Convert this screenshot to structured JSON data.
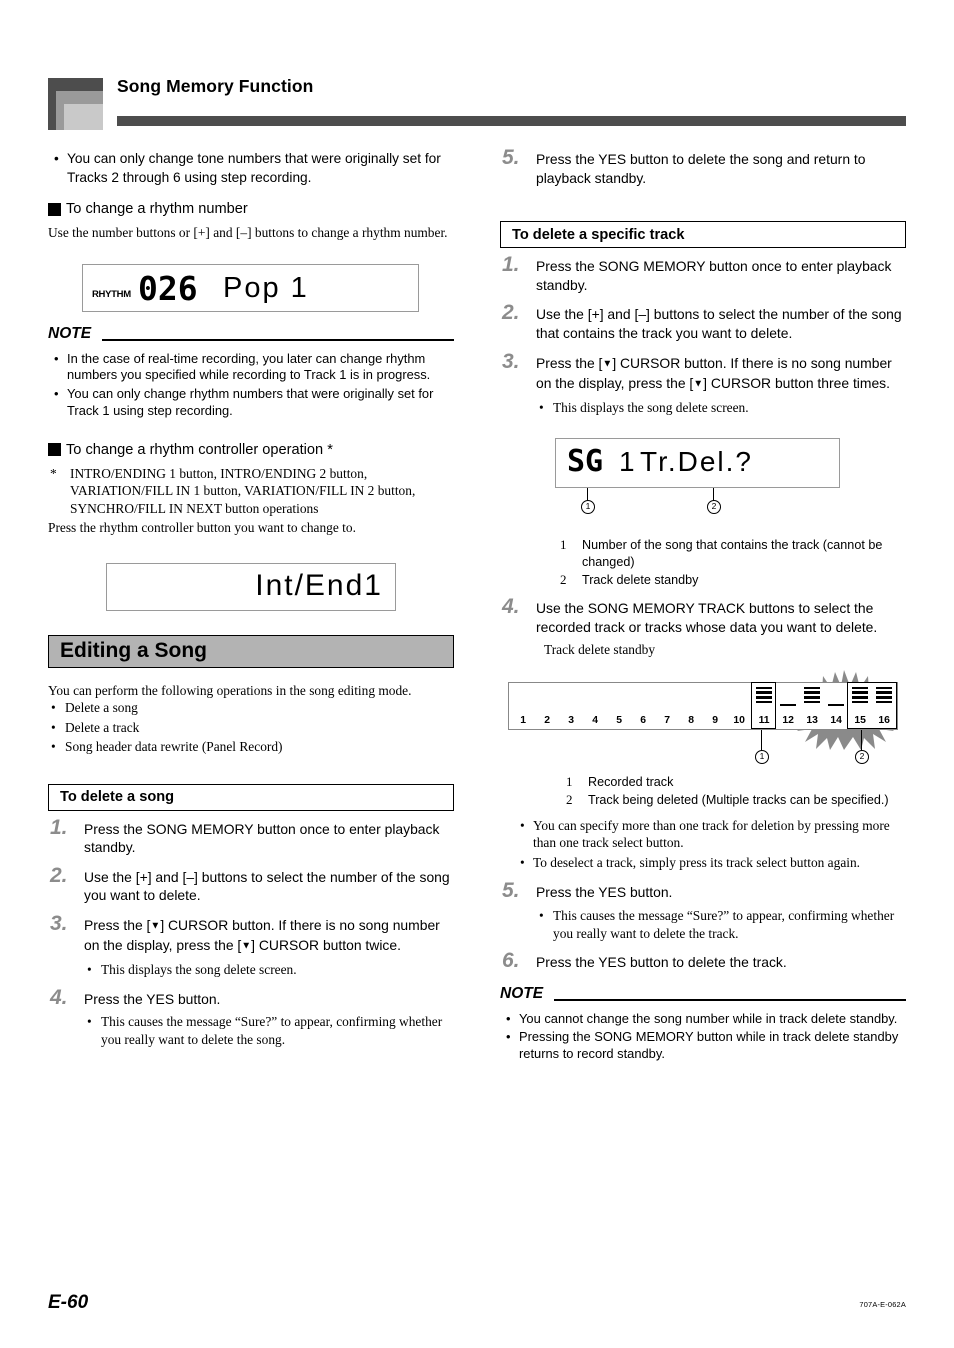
{
  "header": {
    "title": "Song Memory Function"
  },
  "footer": {
    "page_number": "E-60",
    "doc_code": "707A-E-062A"
  },
  "left": {
    "intro_bullet": "You can only change tone numbers that were originally set for Tracks 2 through 6 using step recording.",
    "rhythm_head": "To change a rhythm number",
    "rhythm_body": "Use the number buttons or [+] and [–] buttons to change a rhythm number.",
    "lcd_rhythm": {
      "label": "RHYTHM",
      "number": "026",
      "name": "Pop  1"
    },
    "note_label": "NOTE",
    "notes": [
      "In the case of real-time recording, you later can change rhythm numbers you specified while recording to Track 1 is in progress.",
      "You can only change rhythm numbers that were originally set for Track 1 using step recording."
    ],
    "controller_head": "To change a rhythm controller operation *",
    "controller_footnote_mark": "*",
    "controller_footnote": "INTRO/ENDING 1 button, INTRO/ENDING 2 button, VARIATION/FILL IN 1 button, VARIATION/FILL IN 2 button, SYNCHRO/FILL IN NEXT button operations",
    "controller_body": "Press the rhythm controller button you want to change to.",
    "lcd_controller": "Int/End1",
    "section_banner": "Editing a Song",
    "editing_intro": "You can perform the following operations in the song editing mode.",
    "editing_bullets": [
      "Delete a song",
      "Delete a track",
      "Song header data rewrite (Panel Record)"
    ],
    "proc_title": "To delete a song",
    "steps": [
      {
        "num": "1.",
        "text": "Press the SONG MEMORY button once to enter playback standby."
      },
      {
        "num": "2.",
        "text": "Use the [+] and [–] buttons to select the number of the song you want to delete."
      },
      {
        "num": "3.",
        "text_a": "Press the [",
        "text_b": "] CURSOR button. If there is no song number on the display, press the [",
        "text_c": "] CURSOR button twice.",
        "sub": "This displays the song delete screen."
      },
      {
        "num": "4.",
        "text": "Press the YES button.",
        "sub": "This causes the message “Sure?” to appear, confirming whether you really want to delete the song."
      }
    ]
  },
  "right": {
    "step5_top": {
      "num": "5.",
      "text": "Press the YES button to delete the song and return to playback standby."
    },
    "proc_title": "To delete a specific track",
    "steps": [
      {
        "num": "1.",
        "text": "Press the SONG MEMORY button once to enter playback standby."
      },
      {
        "num": "2.",
        "text": "Use the [+] and [–] buttons to select the number of the song that contains the track you want to delete."
      },
      {
        "num": "3.",
        "text_a": "Press the [",
        "text_b": "] CURSOR button. If there is no song number on the display, press the [",
        "text_c": "] CURSOR button three times.",
        "sub": "This displays the song delete screen."
      }
    ],
    "lcd_track_delete": {
      "seg": "SG",
      "digit": "1",
      "rest": "Tr.Del.?"
    },
    "lcd_legend": [
      {
        "n": "1",
        "text": "Number of the song that contains the track (cannot be changed)"
      },
      {
        "n": "2",
        "text": "Track delete standby"
      }
    ],
    "step4": {
      "num": "4.",
      "text": "Use the SONG MEMORY TRACK buttons to select the recorded track or tracks whose data you want to delete."
    },
    "diagram_caption": "Track delete standby",
    "diagram": {
      "track_numbers": [
        "1",
        "2",
        "3",
        "4",
        "5",
        "6",
        "7",
        "8",
        "9",
        "10",
        "11",
        "12",
        "13",
        "14",
        "15",
        "16"
      ],
      "recorded_tracks": [
        "11",
        "13",
        "15",
        "16"
      ],
      "empty_tracks": [
        "1",
        "2",
        "3",
        "4",
        "5",
        "6",
        "7",
        "8",
        "9",
        "10",
        "12",
        "14"
      ],
      "callout1_track": "11",
      "callout2_tracks": [
        "15",
        "16"
      ],
      "callout1_label": "1",
      "callout2_label": "2"
    },
    "diagram_legend": [
      {
        "n": "1",
        "text": "Recorded track"
      },
      {
        "n": "2",
        "text": "Track being deleted (Multiple tracks can be specified.)"
      }
    ],
    "diagram_bullets": [
      "You can specify more than one track for deletion by pressing more than one track select button.",
      "To deselect a track, simply press its track select button again."
    ],
    "step5": {
      "num": "5.",
      "text": "Press the YES button.",
      "sub": "This causes the message “Sure?” to appear, confirming whether you really want to delete the track."
    },
    "step6": {
      "num": "6.",
      "text": "Press the YES button to delete the track."
    },
    "note_label": "NOTE",
    "notes": [
      "You cannot change the song number while in track delete standby.",
      "Pressing the SONG MEMORY button while in track delete standby returns to record standby."
    ]
  }
}
